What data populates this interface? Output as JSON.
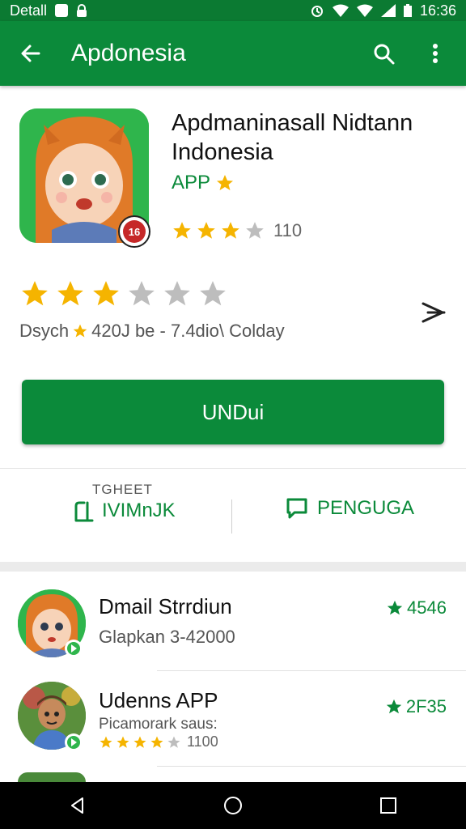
{
  "status_bar": {
    "left_text": "Detall",
    "time": "16:36"
  },
  "app_bar": {
    "title": "Apdonesia"
  },
  "app": {
    "name_line1": "Apdmaninasall Nidtann",
    "name_line2": "Indonesia",
    "type": "APP",
    "age_rating": "16",
    "small_rating_value": 3,
    "small_rating_count": "110",
    "big_rating_value": 3,
    "meta_category": "Dsych",
    "meta_details": "420J be - 7.4dio\\ Colday",
    "install_label": "UNDui"
  },
  "actions": {
    "wishlist_small": "TGHEET",
    "wishlist_label": "IVIMnJK",
    "share_label": "PENGUGA"
  },
  "list": [
    {
      "title": "Dmail Strrdiun",
      "subtitle": "Glapkan  3-42000",
      "score": "4546"
    },
    {
      "title": "Udenns APP",
      "subtitle": "Picamorark saus:",
      "rating": 4,
      "count": "1100",
      "score": "2F35"
    }
  ],
  "colors": {
    "primary": "#0b8a3a",
    "status_bar": "#0b7a32",
    "star": "#f5b400",
    "star_empty": "#bdbdbd"
  },
  "icons": {
    "back": "arrow-left-icon",
    "search": "search-icon",
    "more": "more-vertical-icon",
    "share": "share-icon",
    "wishlist": "bookmark-add-icon",
    "review": "chat-bubble-icon",
    "nav_back": "triangle-back-icon",
    "nav_home": "circle-home-icon",
    "nav_recent": "square-recent-icon"
  }
}
